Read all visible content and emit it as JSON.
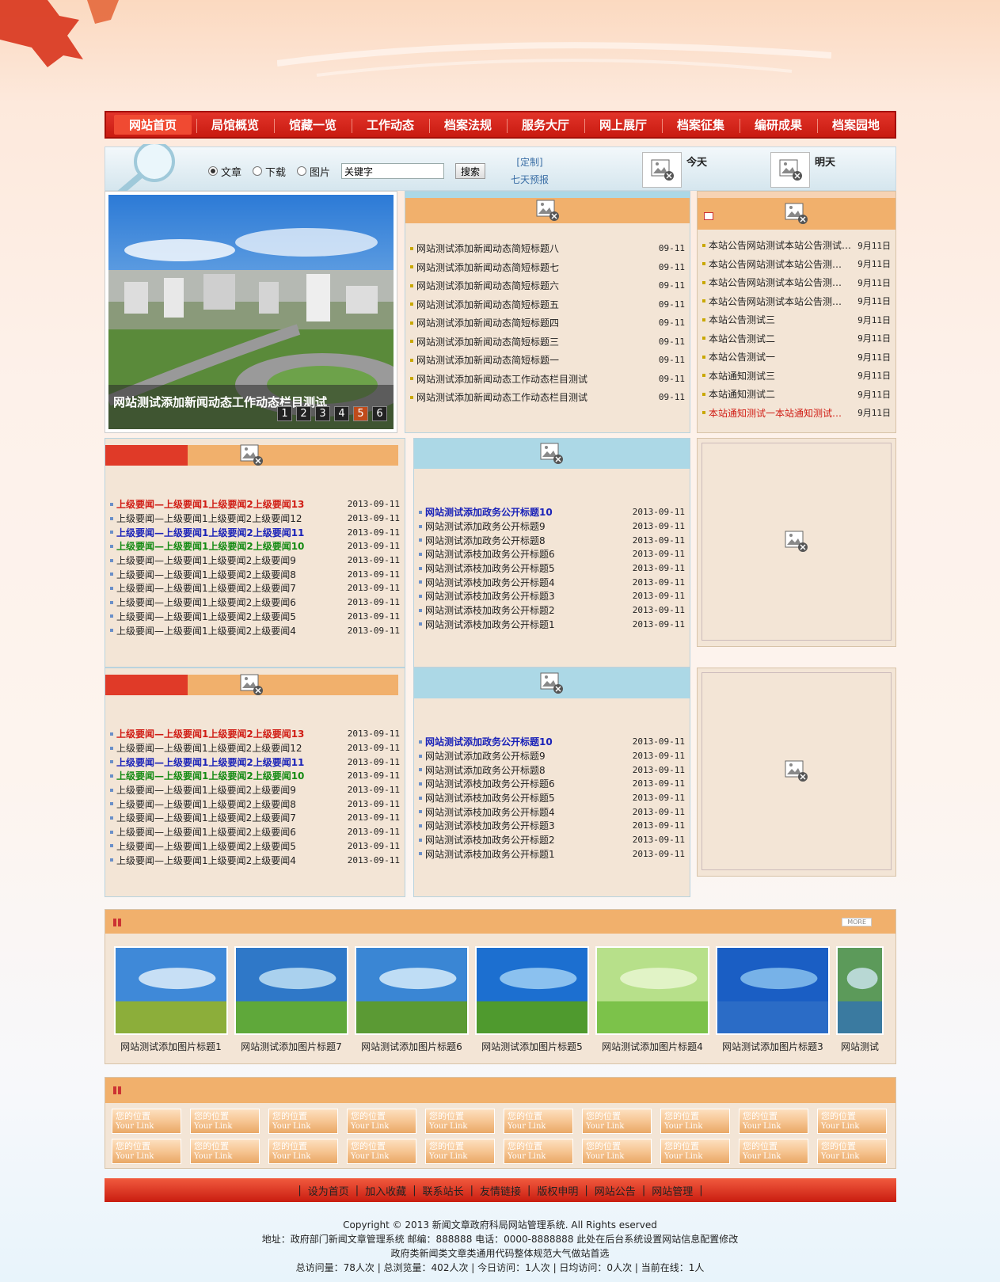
{
  "colors": {
    "nav_red": "#c81a10",
    "panel_beige": "#f3e5d6",
    "head_orange": "#f1b06c",
    "head_blue": "#acd8e6",
    "red_text": "#d01c14",
    "blue_text": "#1a22b8",
    "green_text": "#138a12"
  },
  "nav": {
    "items": [
      "网站首页",
      "局馆概览",
      "馆藏一览",
      "工作动态",
      "档案法规",
      "服务大厅",
      "网上展厅",
      "档案征集",
      "编研成果",
      "档案园地"
    ]
  },
  "search": {
    "options": [
      "文章",
      "下载",
      "图片"
    ],
    "selected": "文章",
    "keyword_value": "关键字",
    "button": "搜索",
    "custom_link": "[定制]",
    "forecast_link": "七天预报",
    "today": "今天",
    "tomorrow": "明天"
  },
  "slider": {
    "caption": "网站测试添加新闻动态工作动态栏目测试",
    "pages": [
      "1",
      "2",
      "3",
      "4",
      "5",
      "6"
    ],
    "active_page": "5"
  },
  "news": [
    {
      "title": "网站测试添加新闻动态简短标题八",
      "date": "09-11"
    },
    {
      "title": "网站测试添加新闻动态简短标题七",
      "date": "09-11"
    },
    {
      "title": "网站测试添加新闻动态简短标题六",
      "date": "09-11"
    },
    {
      "title": "网站测试添加新闻动态简短标题五",
      "date": "09-11"
    },
    {
      "title": "网站测试添加新闻动态简短标题四",
      "date": "09-11"
    },
    {
      "title": "网站测试添加新闻动态简短标题三",
      "date": "09-11"
    },
    {
      "title": "网站测试添加新闻动态简短标题一",
      "date": "09-11"
    },
    {
      "title": "网站测试添加新闻动态工作动态栏目测试",
      "date": "09-11"
    },
    {
      "title": "网站测试添加新闻动态工作动态栏目测试",
      "date": "09-11"
    }
  ],
  "notices": [
    {
      "title": "本站公告网站测试本站公告测试…",
      "date": "9月11日"
    },
    {
      "title": "本站公告网站测试本站公告测…",
      "date": "9月11日"
    },
    {
      "title": "本站公告网站测试本站公告测…",
      "date": "9月11日"
    },
    {
      "title": "本站公告网站测试本站公告测…",
      "date": "9月11日"
    },
    {
      "title": "本站公告测试三",
      "date": "9月11日"
    },
    {
      "title": "本站公告测试二",
      "date": "9月11日"
    },
    {
      "title": "本站公告测试一",
      "date": "9月11日"
    },
    {
      "title": "本站通知测试三",
      "date": "9月11日"
    },
    {
      "title": "本站通知测试二",
      "date": "9月11日"
    },
    {
      "title": "本站通知测试一本站通知测试…",
      "date": "9月11日",
      "style": "red"
    }
  ],
  "superior_news": [
    {
      "title": "上级要闻—上级要闻1上级要闻2上级要闻13",
      "date": "2013-09-11",
      "style": "red"
    },
    {
      "title": "上级要闻—上级要闻1上级要闻2上级要闻12",
      "date": "2013-09-11",
      "style": ""
    },
    {
      "title": "上级要闻—上级要闻1上级要闻2上级要闻11",
      "date": "2013-09-11",
      "style": "blue"
    },
    {
      "title": "上级要闻—上级要闻1上级要闻2上级要闻10",
      "date": "2013-09-11",
      "style": "green"
    },
    {
      "title": "上级要闻—上级要闻1上级要闻2上级要闻9",
      "date": "2013-09-11",
      "style": ""
    },
    {
      "title": "上级要闻—上级要闻1上级要闻2上级要闻8",
      "date": "2013-09-11",
      "style": ""
    },
    {
      "title": "上级要闻—上级要闻1上级要闻2上级要闻7",
      "date": "2013-09-11",
      "style": ""
    },
    {
      "title": "上级要闻—上级要闻1上级要闻2上级要闻6",
      "date": "2013-09-11",
      "style": ""
    },
    {
      "title": "上级要闻—上级要闻1上级要闻2上级要闻5",
      "date": "2013-09-11",
      "style": ""
    },
    {
      "title": "上级要闻—上级要闻1上级要闻2上级要闻4",
      "date": "2013-09-11",
      "style": ""
    }
  ],
  "gov_news": [
    {
      "title": "网站测试添加政务公开标题10",
      "date": "2013-09-11",
      "style": "blue"
    },
    {
      "title": "网站测试添加政务公开标题9",
      "date": "2013-09-11",
      "style": ""
    },
    {
      "title": "网站测试添加政务公开标题8",
      "date": "2013-09-11",
      "style": ""
    },
    {
      "title": "网站测试添枝加政务公开标题6",
      "date": "2013-09-11",
      "style": ""
    },
    {
      "title": "网站测试添枝加政务公开标题5",
      "date": "2013-09-11",
      "style": ""
    },
    {
      "title": "网站测试添枝加政务公开标题4",
      "date": "2013-09-11",
      "style": ""
    },
    {
      "title": "网站测试添枝加政务公开标题3",
      "date": "2013-09-11",
      "style": ""
    },
    {
      "title": "网站测试添枝加政务公开标题2",
      "date": "2013-09-11",
      "style": ""
    },
    {
      "title": "网站测试添枝加政务公开标题1",
      "date": "2013-09-11",
      "style": ""
    }
  ],
  "gallery": {
    "more": "MORE",
    "items": [
      "网站测试添加图片标题1",
      "网站测试添加图片标题7",
      "网站测试添加图片标题6",
      "网站测试添加图片标题5",
      "网站测试添加图片标题4",
      "网站测试添加图片标题3",
      "网站测试"
    ]
  },
  "links": {
    "title": "您的位置",
    "subtitle": "Your Link",
    "count": 20
  },
  "footer": {
    "links": [
      "设为首页",
      "加入收藏",
      "联系站长",
      "友情链接",
      "版权申明",
      "网站公告",
      "网站管理"
    ],
    "copyright": "Copyright © 2013 新闻文章政府科局网站管理系统. All Rights eserved",
    "address": "地址：政府部门新闻文章管理系统 邮编：888888 电话：0000-8888888 此处在后台系统设置网站信息配置修改",
    "slogan": "政府类新闻类文章类通用代码整体规范大气做站首选",
    "stats": "总访问量：78人次 | 总浏览量：402人次 | 今日访问：1人次 | 日均访问：0人次 | 当前在线：1人"
  }
}
